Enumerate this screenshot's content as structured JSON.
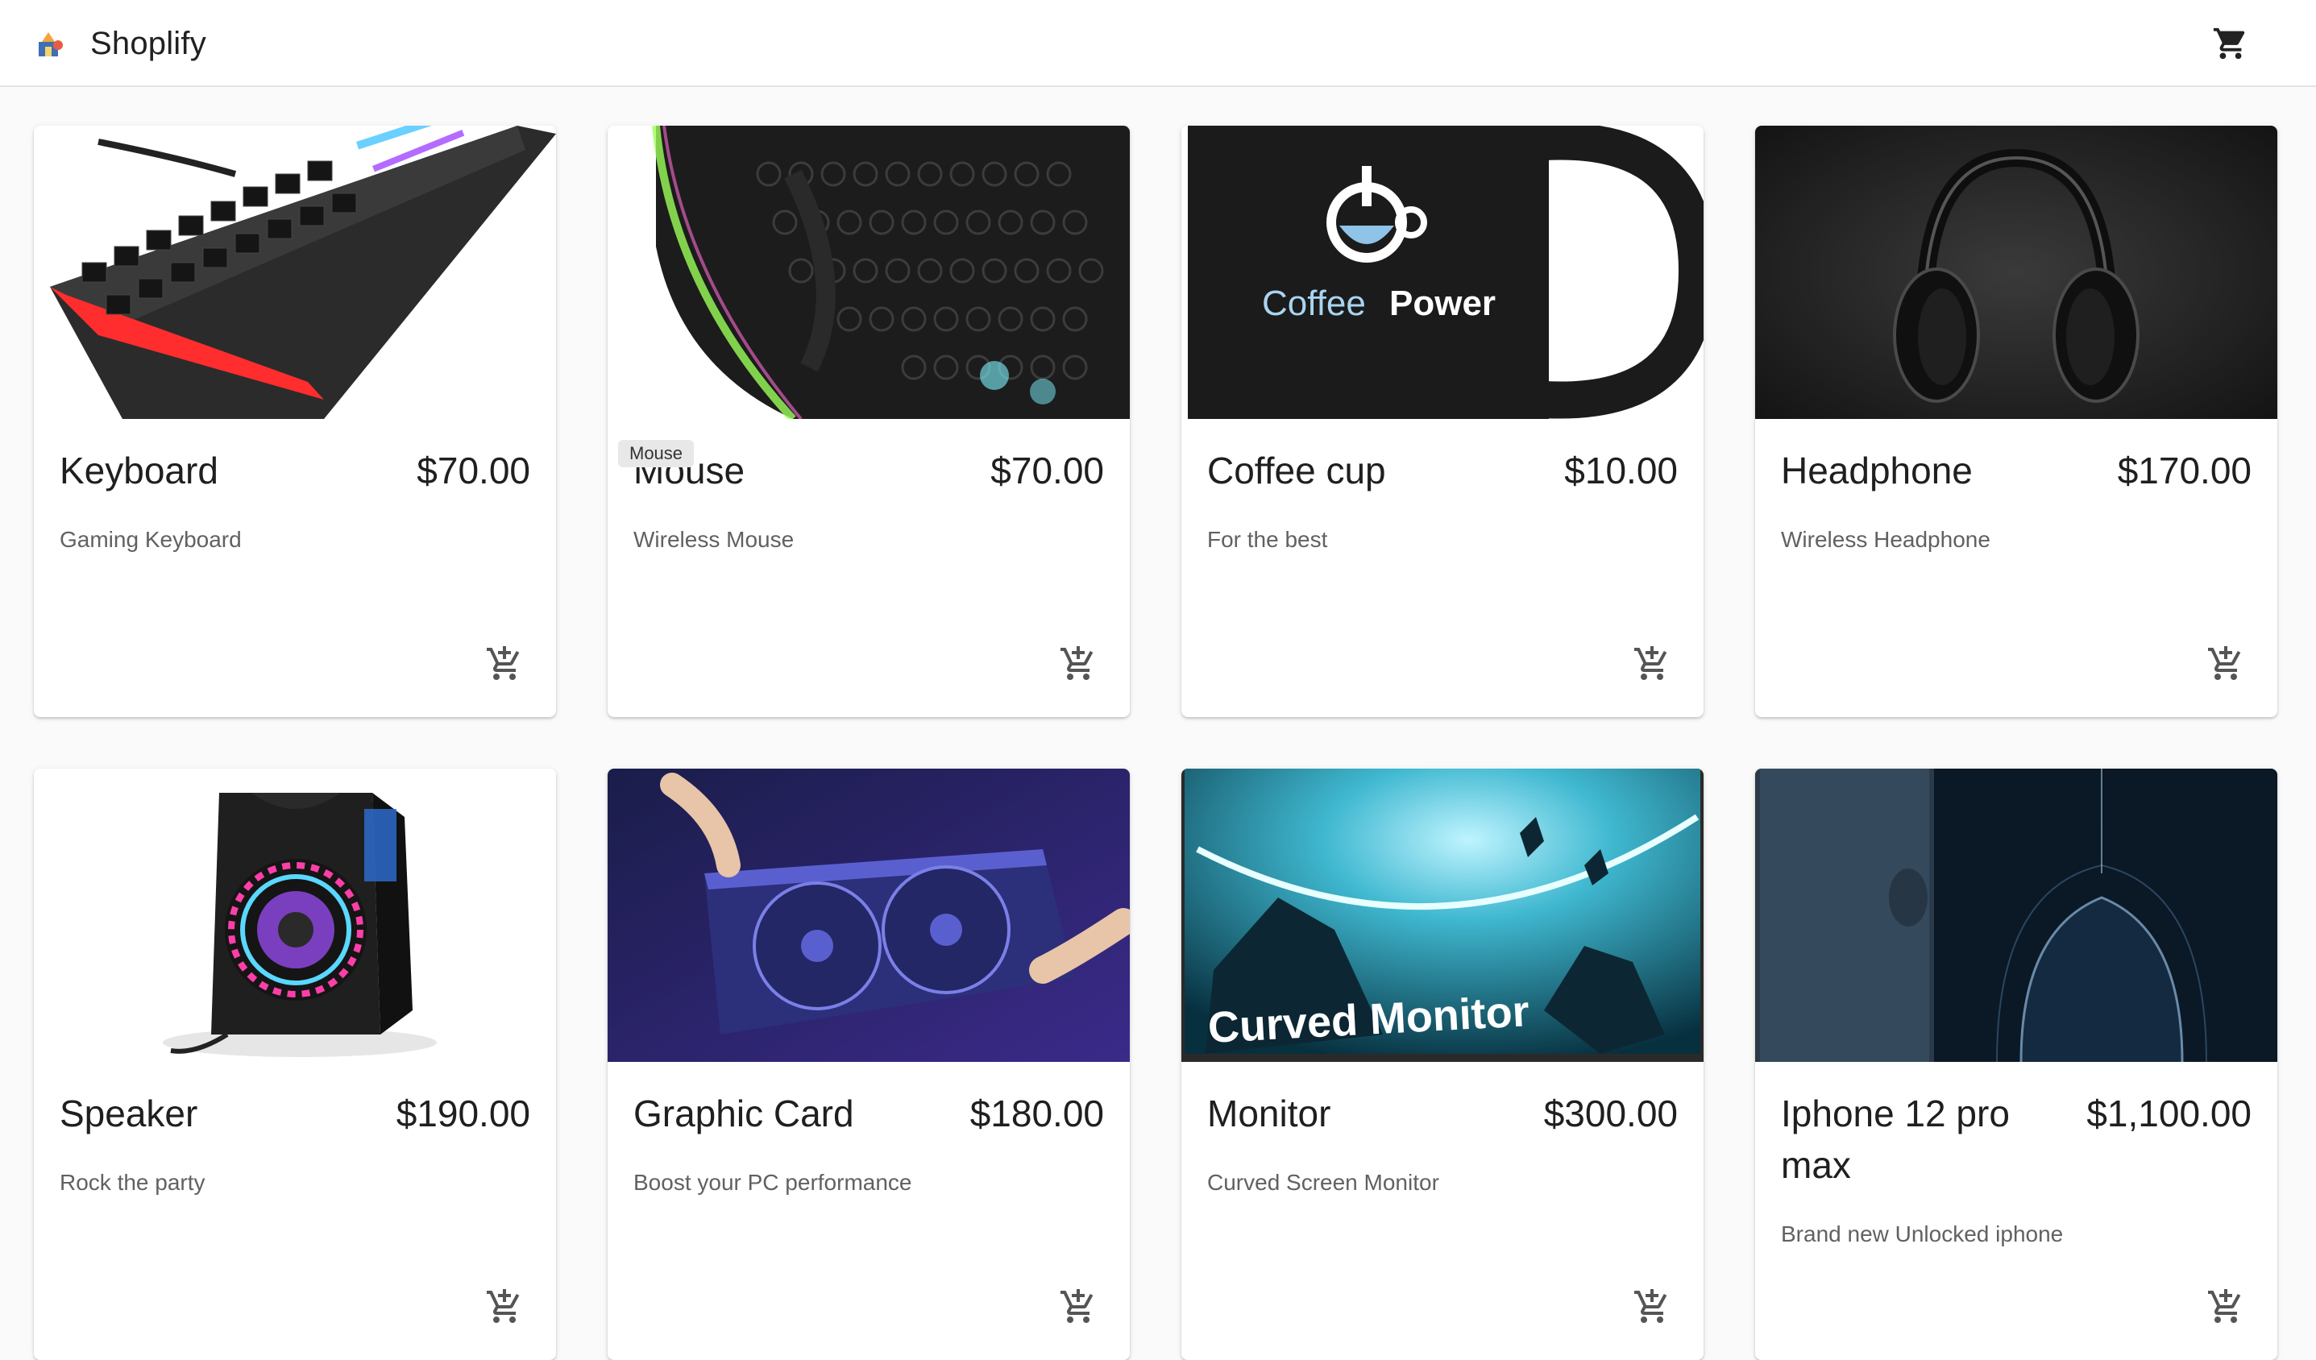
{
  "header": {
    "title": "Shoplify",
    "logo_icon": "shop-logo-icon",
    "cart_icon": "shopping-cart-icon"
  },
  "tooltip": {
    "text": "Mouse"
  },
  "products": [
    {
      "name": "Keyboard",
      "price": "$70.00",
      "description": "Gaming Keyboard",
      "add_icon": "add-shopping-cart-icon"
    },
    {
      "name": "Mouse",
      "price": "$70.00",
      "description": "Wireless Mouse",
      "add_icon": "add-shopping-cart-icon"
    },
    {
      "name": "Coffee cup",
      "price": "$10.00",
      "description": "For the best",
      "add_icon": "add-shopping-cart-icon",
      "image_text": {
        "brand_a": "Coffee",
        "brand_b": "Power"
      }
    },
    {
      "name": "Headphone",
      "price": "$170.00",
      "description": "Wireless Headphone",
      "add_icon": "add-shopping-cart-icon"
    },
    {
      "name": "Speaker",
      "price": "$190.00",
      "description": "Rock the party",
      "add_icon": "add-shopping-cart-icon"
    },
    {
      "name": "Graphic Card",
      "price": "$180.00",
      "description": "Boost your PC performance",
      "add_icon": "add-shopping-cart-icon"
    },
    {
      "name": "Monitor",
      "price": "$300.00",
      "description": "Curved Screen Monitor",
      "add_icon": "add-shopping-cart-icon",
      "image_text": {
        "caption": "Curved Monitor"
      }
    },
    {
      "name": "Iphone 12 pro max",
      "price": "$1,100.00",
      "description": "Brand new Unlocked iphone",
      "add_icon": "add-shopping-cart-icon"
    }
  ]
}
